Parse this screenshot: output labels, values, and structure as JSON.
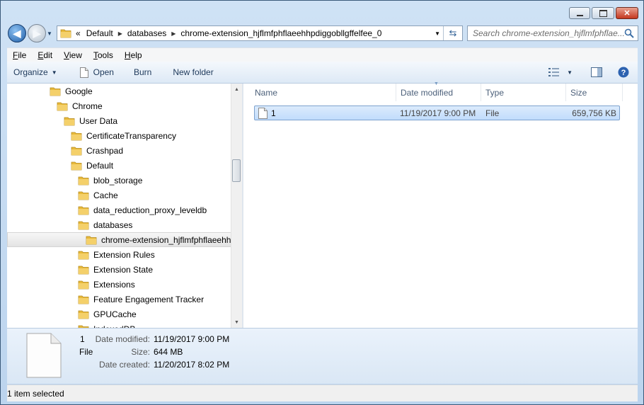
{
  "window": {
    "minimize_label": "–",
    "maximize_label": "□",
    "close_label": "✕"
  },
  "address": {
    "overflow": "«",
    "crumbs": [
      "Default",
      "databases",
      "chrome-extension_hjflmfphflaeehhpdiggobllgffelfee_0"
    ]
  },
  "search": {
    "placeholder": "Search chrome-extension_hjflmfphflae..."
  },
  "menu": [
    {
      "label": "File",
      "key": "F",
      "rest": "ile"
    },
    {
      "label": "Edit",
      "key": "E",
      "rest": "dit"
    },
    {
      "label": "View",
      "key": "V",
      "rest": "iew"
    },
    {
      "label": "Tools",
      "key": "T",
      "rest": "ools"
    },
    {
      "label": "Help",
      "key": "H",
      "rest": "elp"
    }
  ],
  "toolbar": {
    "organize": "Organize",
    "open": "Open",
    "burn": "Burn",
    "new_folder": "New folder"
  },
  "tree": [
    {
      "label": "Google",
      "level": 0
    },
    {
      "label": "Chrome",
      "level": 1
    },
    {
      "label": "User Data",
      "level": 2
    },
    {
      "label": "CertificateTransparency",
      "level": 3
    },
    {
      "label": "Crashpad",
      "level": 3
    },
    {
      "label": "Default",
      "level": 3
    },
    {
      "label": "blob_storage",
      "level": 4
    },
    {
      "label": "Cache",
      "level": 4
    },
    {
      "label": "data_reduction_proxy_leveldb",
      "level": 4
    },
    {
      "label": "databases",
      "level": 4
    },
    {
      "label": "chrome-extension_hjflmfphflaeehh",
      "level": 5,
      "selected": true
    },
    {
      "label": "Extension Rules",
      "level": 4
    },
    {
      "label": "Extension State",
      "level": 4
    },
    {
      "label": "Extensions",
      "level": 4
    },
    {
      "label": "Feature Engagement Tracker",
      "level": 4
    },
    {
      "label": "GPUCache",
      "level": 4
    },
    {
      "label": "IndexedDB",
      "level": 4
    }
  ],
  "columns": {
    "name": "Name",
    "date_modified": "Date modified",
    "type": "Type",
    "size": "Size"
  },
  "files": [
    {
      "name": "1",
      "date_modified": "11/19/2017 9:00 PM",
      "type": "File",
      "size": "659,756 KB"
    }
  ],
  "details": {
    "name": "1",
    "type": "File",
    "date_modified_label": "Date modified:",
    "date_modified": "11/19/2017 9:00 PM",
    "size_label": "Size:",
    "size": "644 MB",
    "date_created_label": "Date created:",
    "date_created": "11/20/2017 8:02 PM"
  },
  "status": {
    "text": "1 item selected"
  },
  "colors": {
    "folder": "#e8b93a",
    "selection": "#c1dcfc",
    "header_text": "#4c607a"
  }
}
